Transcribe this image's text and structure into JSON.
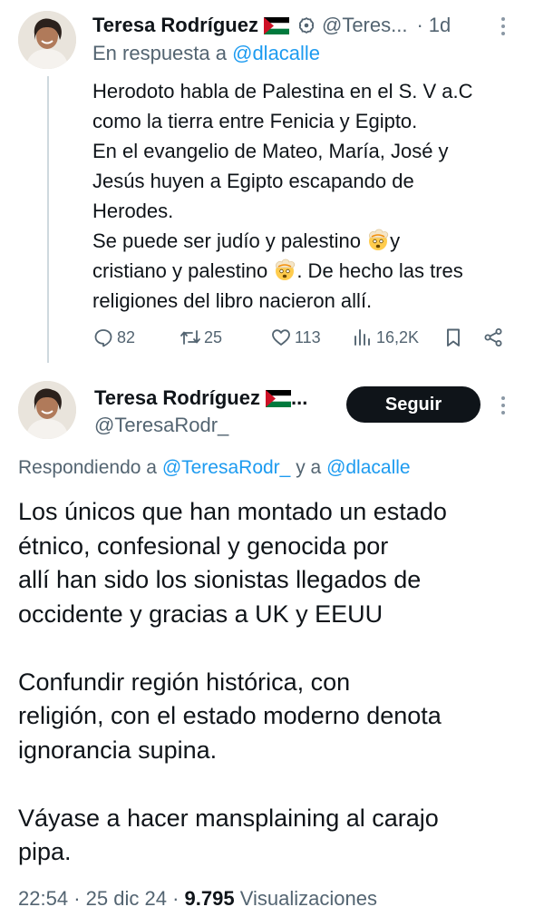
{
  "reply_tweet": {
    "author_name": "Teresa Rodríguez",
    "author_handle": "@Teres...",
    "separator": "·",
    "time": "1d",
    "in_reply_prefix": "En respuesta a",
    "in_reply_mention": "@dlacalle",
    "text_lines": [
      "Herodoto habla de Palestina en el S. V a.C",
      "como la tierra entre Fenicia y Egipto.",
      "En el evangelio de Mateo, María, José y",
      "Jesús huyen a Egipto escapando de",
      "Herodes."
    ],
    "text_line6_a": "Se puede ser judío y palestino ",
    "text_line6_b": "y",
    "text_line7_a": "cristiano y palestino ",
    "text_line7_b": ". De hecho las tres",
    "text_line8": "religiones del libro nacieron allí.",
    "emoji": "exploding-head-emoji",
    "stats": {
      "replies": "82",
      "reposts": "25",
      "likes": "113",
      "views": "16,2K"
    }
  },
  "main_tweet": {
    "author_name": "Teresa Rodríguez",
    "name_ellipsis": "...",
    "author_handle": "@TeresaRodr_",
    "follow_label": "Seguir",
    "replying_prefix": "Respondiendo a",
    "replying_mention1": "@TeresaRodr_",
    "replying_conj": "y a",
    "replying_mention2": "@dlacalle",
    "paragraph1": [
      "Los únicos que han montado un estado",
      "étnico, confesional y genocida por",
      "allí han sido los sionistas llegados de",
      "occidente y gracias a UK y EEUU"
    ],
    "paragraph2": [
      "Confundir región histórica, con",
      "religión, con el estado moderno denota",
      "ignorancia supina."
    ],
    "paragraph3": [
      "Váyase a hacer mansplaining al carajo",
      "pipa."
    ],
    "meta": {
      "time": "22:54",
      "sep1": "·",
      "date": "25 dic 24",
      "sep2": "·",
      "views_count": "9.795",
      "views_label": "Visualizaciones"
    }
  },
  "colors": {
    "text": "#0f1419",
    "secondary": "#536471",
    "link": "#1d9bf0",
    "thread_line": "#cfd9de",
    "follow_bg": "#0f1419",
    "flag_red": "#ce1126",
    "flag_green": "#007a3d"
  },
  "icons": [
    "reply-icon",
    "repost-icon",
    "like-icon",
    "views-icon",
    "bookmark-icon",
    "share-icon",
    "verified-icon",
    "palestine-flag-icon",
    "more-icon"
  ]
}
